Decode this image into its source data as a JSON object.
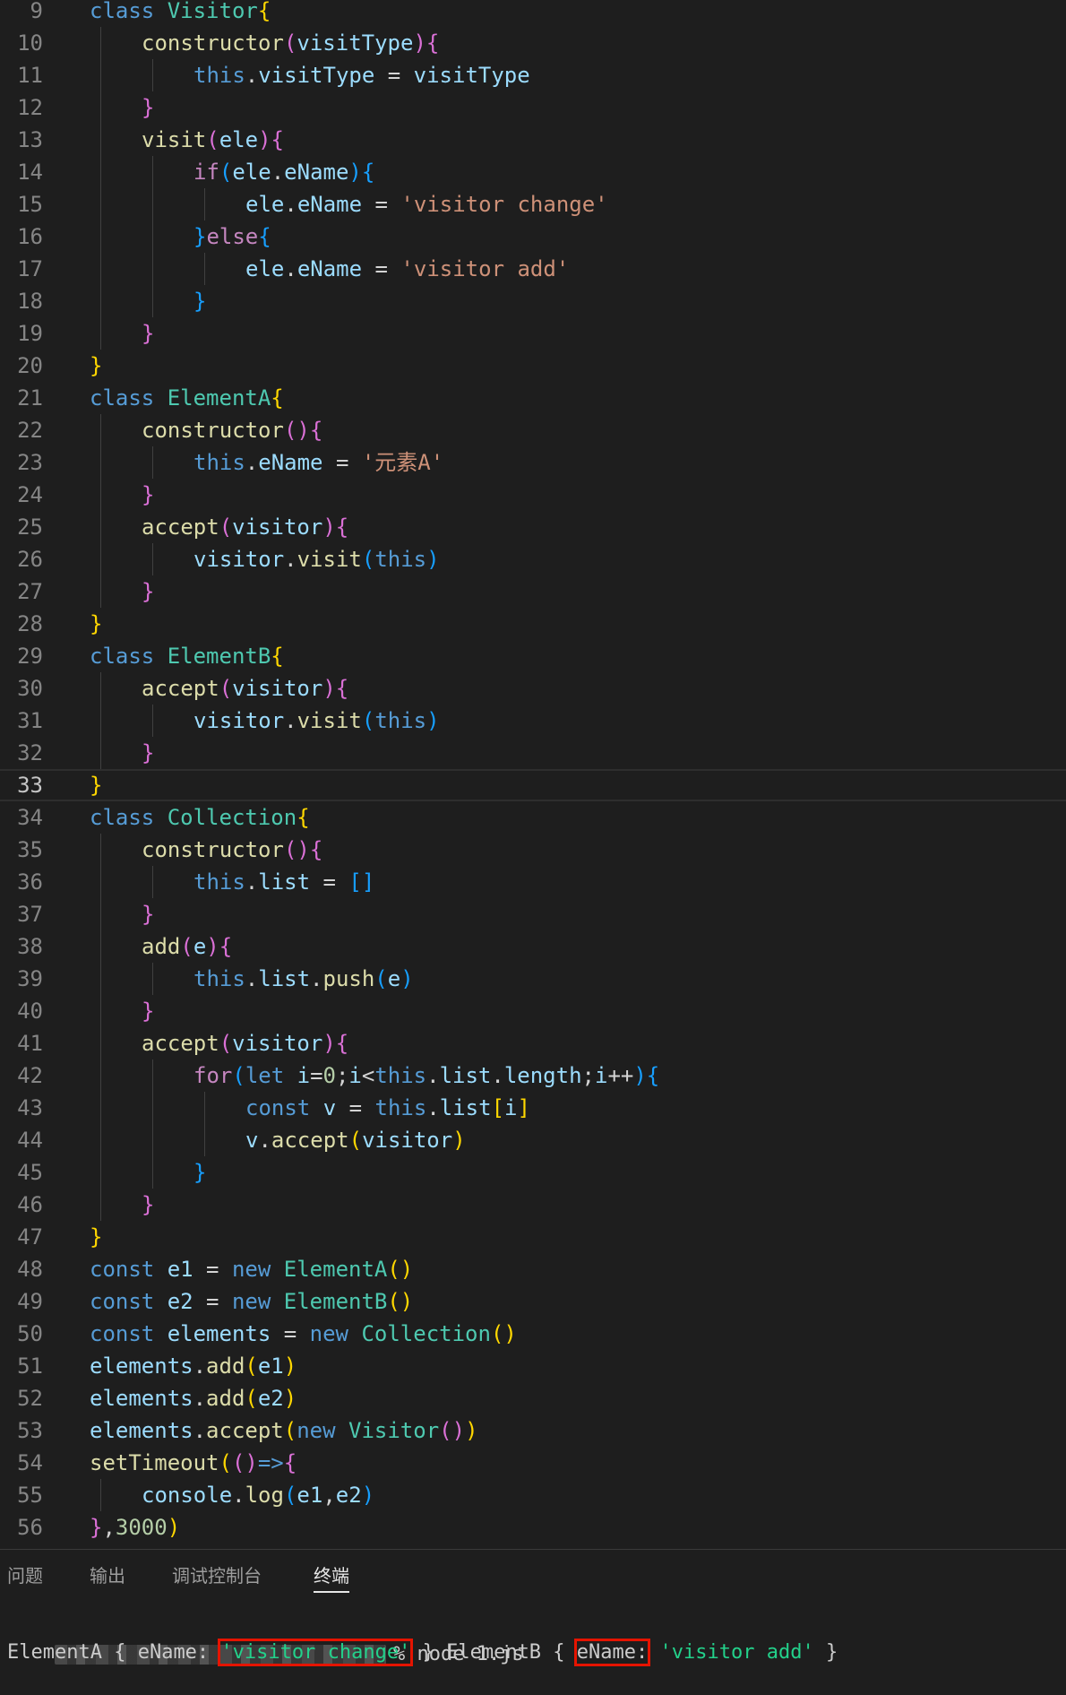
{
  "editor": {
    "current_line": 33,
    "lines": [
      {
        "n": "9",
        "indent": 0,
        "tokens": [
          [
            "kw",
            "class "
          ],
          [
            "cls",
            "Visitor"
          ],
          [
            "b1",
            "{"
          ]
        ]
      },
      {
        "n": "10",
        "indent": 1,
        "tokens": [
          [
            "fn",
            "constructor"
          ],
          [
            "b2",
            "("
          ],
          [
            "var",
            "visitType"
          ],
          [
            "b2",
            ")"
          ],
          [
            "b2",
            "{"
          ]
        ]
      },
      {
        "n": "11",
        "indent": 2,
        "tokens": [
          [
            "kw",
            "this"
          ],
          [
            "op",
            "."
          ],
          [
            "var",
            "visitType"
          ],
          [
            "op",
            " = "
          ],
          [
            "var",
            "visitType"
          ]
        ]
      },
      {
        "n": "12",
        "indent": 1,
        "tokens": [
          [
            "b2",
            "}"
          ]
        ]
      },
      {
        "n": "13",
        "indent": 1,
        "tokens": [
          [
            "fn",
            "visit"
          ],
          [
            "b2",
            "("
          ],
          [
            "var",
            "ele"
          ],
          [
            "b2",
            ")"
          ],
          [
            "b2",
            "{"
          ]
        ]
      },
      {
        "n": "14",
        "indent": 2,
        "tokens": [
          [
            "ctrl",
            "if"
          ],
          [
            "b3",
            "("
          ],
          [
            "var",
            "ele"
          ],
          [
            "op",
            "."
          ],
          [
            "var",
            "eName"
          ],
          [
            "b3",
            ")"
          ],
          [
            "b3",
            "{"
          ]
        ]
      },
      {
        "n": "15",
        "indent": 3,
        "tokens": [
          [
            "var",
            "ele"
          ],
          [
            "op",
            "."
          ],
          [
            "var",
            "eName"
          ],
          [
            "op",
            " = "
          ],
          [
            "str",
            "'visitor change'"
          ]
        ]
      },
      {
        "n": "16",
        "indent": 2,
        "tokens": [
          [
            "b3",
            "}"
          ],
          [
            "ctrl",
            "else"
          ],
          [
            "b3",
            "{"
          ]
        ]
      },
      {
        "n": "17",
        "indent": 3,
        "tokens": [
          [
            "var",
            "ele"
          ],
          [
            "op",
            "."
          ],
          [
            "var",
            "eName"
          ],
          [
            "op",
            " = "
          ],
          [
            "str",
            "'visitor add'"
          ]
        ]
      },
      {
        "n": "18",
        "indent": 2,
        "tokens": [
          [
            "b3",
            "}"
          ]
        ]
      },
      {
        "n": "19",
        "indent": 1,
        "tokens": [
          [
            "b2",
            "}"
          ]
        ]
      },
      {
        "n": "20",
        "indent": 0,
        "tokens": [
          [
            "b1",
            "}"
          ]
        ]
      },
      {
        "n": "21",
        "indent": 0,
        "tokens": [
          [
            "kw",
            "class "
          ],
          [
            "cls",
            "ElementA"
          ],
          [
            "b1",
            "{"
          ]
        ]
      },
      {
        "n": "22",
        "indent": 1,
        "tokens": [
          [
            "fn",
            "constructor"
          ],
          [
            "b2",
            "("
          ],
          [
            "b2",
            ")"
          ],
          [
            "b2",
            "{"
          ]
        ]
      },
      {
        "n": "23",
        "indent": 2,
        "tokens": [
          [
            "kw",
            "this"
          ],
          [
            "op",
            "."
          ],
          [
            "var",
            "eName"
          ],
          [
            "op",
            " = "
          ],
          [
            "str",
            "'元素A'"
          ]
        ]
      },
      {
        "n": "24",
        "indent": 1,
        "tokens": [
          [
            "b2",
            "}"
          ]
        ]
      },
      {
        "n": "25",
        "indent": 1,
        "tokens": [
          [
            "fn",
            "accept"
          ],
          [
            "b2",
            "("
          ],
          [
            "var",
            "visitor"
          ],
          [
            "b2",
            ")"
          ],
          [
            "b2",
            "{"
          ]
        ]
      },
      {
        "n": "26",
        "indent": 2,
        "tokens": [
          [
            "var",
            "visitor"
          ],
          [
            "op",
            "."
          ],
          [
            "fn",
            "visit"
          ],
          [
            "b3",
            "("
          ],
          [
            "kw",
            "this"
          ],
          [
            "b3",
            ")"
          ]
        ]
      },
      {
        "n": "27",
        "indent": 1,
        "tokens": [
          [
            "b2",
            "}"
          ]
        ]
      },
      {
        "n": "28",
        "indent": 0,
        "tokens": [
          [
            "b1",
            "}"
          ]
        ]
      },
      {
        "n": "29",
        "indent": 0,
        "tokens": [
          [
            "kw",
            "class "
          ],
          [
            "cls",
            "ElementB"
          ],
          [
            "b1",
            "{"
          ]
        ]
      },
      {
        "n": "30",
        "indent": 1,
        "tokens": [
          [
            "fn",
            "accept"
          ],
          [
            "b2",
            "("
          ],
          [
            "var",
            "visitor"
          ],
          [
            "b2",
            ")"
          ],
          [
            "b2",
            "{"
          ]
        ]
      },
      {
        "n": "31",
        "indent": 2,
        "tokens": [
          [
            "var",
            "visitor"
          ],
          [
            "op",
            "."
          ],
          [
            "fn",
            "visit"
          ],
          [
            "b3",
            "("
          ],
          [
            "kw",
            "this"
          ],
          [
            "b3",
            ")"
          ]
        ]
      },
      {
        "n": "32",
        "indent": 1,
        "tokens": [
          [
            "b2",
            "}"
          ]
        ]
      },
      {
        "n": "33",
        "indent": 0,
        "tokens": [
          [
            "b1",
            "}"
          ]
        ]
      },
      {
        "n": "34",
        "indent": 0,
        "tokens": [
          [
            "kw",
            "class "
          ],
          [
            "cls",
            "Collection"
          ],
          [
            "b1",
            "{"
          ]
        ]
      },
      {
        "n": "35",
        "indent": 1,
        "tokens": [
          [
            "fn",
            "constructor"
          ],
          [
            "b2",
            "("
          ],
          [
            "b2",
            ")"
          ],
          [
            "b2",
            "{"
          ]
        ]
      },
      {
        "n": "36",
        "indent": 2,
        "tokens": [
          [
            "kw",
            "this"
          ],
          [
            "op",
            "."
          ],
          [
            "var",
            "list"
          ],
          [
            "op",
            " = "
          ],
          [
            "b3",
            "[]"
          ]
        ]
      },
      {
        "n": "37",
        "indent": 1,
        "tokens": [
          [
            "b2",
            "}"
          ]
        ]
      },
      {
        "n": "38",
        "indent": 1,
        "tokens": [
          [
            "fn",
            "add"
          ],
          [
            "b2",
            "("
          ],
          [
            "var",
            "e"
          ],
          [
            "b2",
            ")"
          ],
          [
            "b2",
            "{"
          ]
        ]
      },
      {
        "n": "39",
        "indent": 2,
        "tokens": [
          [
            "kw",
            "this"
          ],
          [
            "op",
            "."
          ],
          [
            "var",
            "list"
          ],
          [
            "op",
            "."
          ],
          [
            "fn",
            "push"
          ],
          [
            "b3",
            "("
          ],
          [
            "var",
            "e"
          ],
          [
            "b3",
            ")"
          ]
        ]
      },
      {
        "n": "40",
        "indent": 1,
        "tokens": [
          [
            "b2",
            "}"
          ]
        ]
      },
      {
        "n": "41",
        "indent": 1,
        "tokens": [
          [
            "fn",
            "accept"
          ],
          [
            "b2",
            "("
          ],
          [
            "var",
            "visitor"
          ],
          [
            "b2",
            ")"
          ],
          [
            "b2",
            "{"
          ]
        ]
      },
      {
        "n": "42",
        "indent": 2,
        "tokens": [
          [
            "ctrl",
            "for"
          ],
          [
            "b3",
            "("
          ],
          [
            "kw",
            "let "
          ],
          [
            "var",
            "i"
          ],
          [
            "op",
            "="
          ],
          [
            "num",
            "0"
          ],
          [
            "op",
            ";"
          ],
          [
            "var",
            "i"
          ],
          [
            "op",
            "<"
          ],
          [
            "kw",
            "this"
          ],
          [
            "op",
            "."
          ],
          [
            "var",
            "list"
          ],
          [
            "op",
            "."
          ],
          [
            "var",
            "length"
          ],
          [
            "op",
            ";"
          ],
          [
            "var",
            "i"
          ],
          [
            "op",
            "++"
          ],
          [
            "b3",
            ")"
          ],
          [
            "b3",
            "{"
          ]
        ]
      },
      {
        "n": "43",
        "indent": 3,
        "tokens": [
          [
            "kw",
            "const "
          ],
          [
            "var",
            "v"
          ],
          [
            "op",
            " = "
          ],
          [
            "kw",
            "this"
          ],
          [
            "op",
            "."
          ],
          [
            "var",
            "list"
          ],
          [
            "b1",
            "["
          ],
          [
            "var",
            "i"
          ],
          [
            "b1",
            "]"
          ]
        ]
      },
      {
        "n": "44",
        "indent": 3,
        "tokens": [
          [
            "var",
            "v"
          ],
          [
            "op",
            "."
          ],
          [
            "fn",
            "accept"
          ],
          [
            "b1",
            "("
          ],
          [
            "var",
            "visitor"
          ],
          [
            "b1",
            ")"
          ]
        ]
      },
      {
        "n": "45",
        "indent": 2,
        "tokens": [
          [
            "b3",
            "}"
          ]
        ]
      },
      {
        "n": "46",
        "indent": 1,
        "tokens": [
          [
            "b2",
            "}"
          ]
        ]
      },
      {
        "n": "47",
        "indent": 0,
        "tokens": [
          [
            "b1",
            "}"
          ]
        ]
      },
      {
        "n": "48",
        "indent": 0,
        "tokens": [
          [
            "kw",
            "const "
          ],
          [
            "var",
            "e1"
          ],
          [
            "op",
            " = "
          ],
          [
            "kw",
            "new "
          ],
          [
            "cls",
            "ElementA"
          ],
          [
            "b1",
            "()"
          ]
        ]
      },
      {
        "n": "49",
        "indent": 0,
        "tokens": [
          [
            "kw",
            "const "
          ],
          [
            "var",
            "e2"
          ],
          [
            "op",
            " = "
          ],
          [
            "kw",
            "new "
          ],
          [
            "cls",
            "ElementB"
          ],
          [
            "b1",
            "()"
          ]
        ]
      },
      {
        "n": "50",
        "indent": 0,
        "tokens": [
          [
            "kw",
            "const "
          ],
          [
            "var",
            "elements"
          ],
          [
            "op",
            " = "
          ],
          [
            "kw",
            "new "
          ],
          [
            "cls",
            "Collection"
          ],
          [
            "b1",
            "()"
          ]
        ]
      },
      {
        "n": "51",
        "indent": 0,
        "tokens": [
          [
            "var",
            "elements"
          ],
          [
            "op",
            "."
          ],
          [
            "fn",
            "add"
          ],
          [
            "b1",
            "("
          ],
          [
            "var",
            "e1"
          ],
          [
            "b1",
            ")"
          ]
        ]
      },
      {
        "n": "52",
        "indent": 0,
        "tokens": [
          [
            "var",
            "elements"
          ],
          [
            "op",
            "."
          ],
          [
            "fn",
            "add"
          ],
          [
            "b1",
            "("
          ],
          [
            "var",
            "e2"
          ],
          [
            "b1",
            ")"
          ]
        ]
      },
      {
        "n": "53",
        "indent": 0,
        "tokens": [
          [
            "var",
            "elements"
          ],
          [
            "op",
            "."
          ],
          [
            "fn",
            "accept"
          ],
          [
            "b1",
            "("
          ],
          [
            "kw",
            "new "
          ],
          [
            "cls",
            "Visitor"
          ],
          [
            "b2",
            "()"
          ],
          [
            "b1",
            ")"
          ]
        ]
      },
      {
        "n": "54",
        "indent": 0,
        "tokens": [
          [
            "fn",
            "setTimeout"
          ],
          [
            "b1",
            "("
          ],
          [
            "b2",
            "()"
          ],
          [
            "kw",
            "=>"
          ],
          [
            "b2",
            "{"
          ]
        ]
      },
      {
        "n": "55",
        "indent": 1,
        "tokens": [
          [
            "var",
            "console"
          ],
          [
            "op",
            "."
          ],
          [
            "fn",
            "log"
          ],
          [
            "b3",
            "("
          ],
          [
            "var",
            "e1"
          ],
          [
            "op",
            ","
          ],
          [
            "var",
            "e2"
          ],
          [
            "b3",
            ")"
          ]
        ]
      },
      {
        "n": "56",
        "indent": 0,
        "tokens": [
          [
            "b2",
            "}"
          ],
          [
            "op",
            ","
          ],
          [
            "num",
            "3000"
          ],
          [
            "b1",
            ")"
          ]
        ]
      }
    ]
  },
  "panel": {
    "tabs": [
      {
        "label": "问题",
        "active": false
      },
      {
        "label": "输出",
        "active": false
      },
      {
        "label": "调试控制台",
        "active": false
      },
      {
        "label": "终端",
        "active": true
      }
    ],
    "terminal": {
      "command": "% node 1.js",
      "output": {
        "a_prefix": "ElementA { ",
        "a_key": "eName:",
        "a_space": " ",
        "a_value": "'visitor change'",
        "mid": " } ElementB { ",
        "b_key": "eName:",
        "b_space": " ",
        "b_value": "'visitor add'",
        "end": " }"
      }
    }
  },
  "colors": {
    "background": "#1e1e1e",
    "highlight_box": "#e51400",
    "string_output": "#23d18b"
  }
}
